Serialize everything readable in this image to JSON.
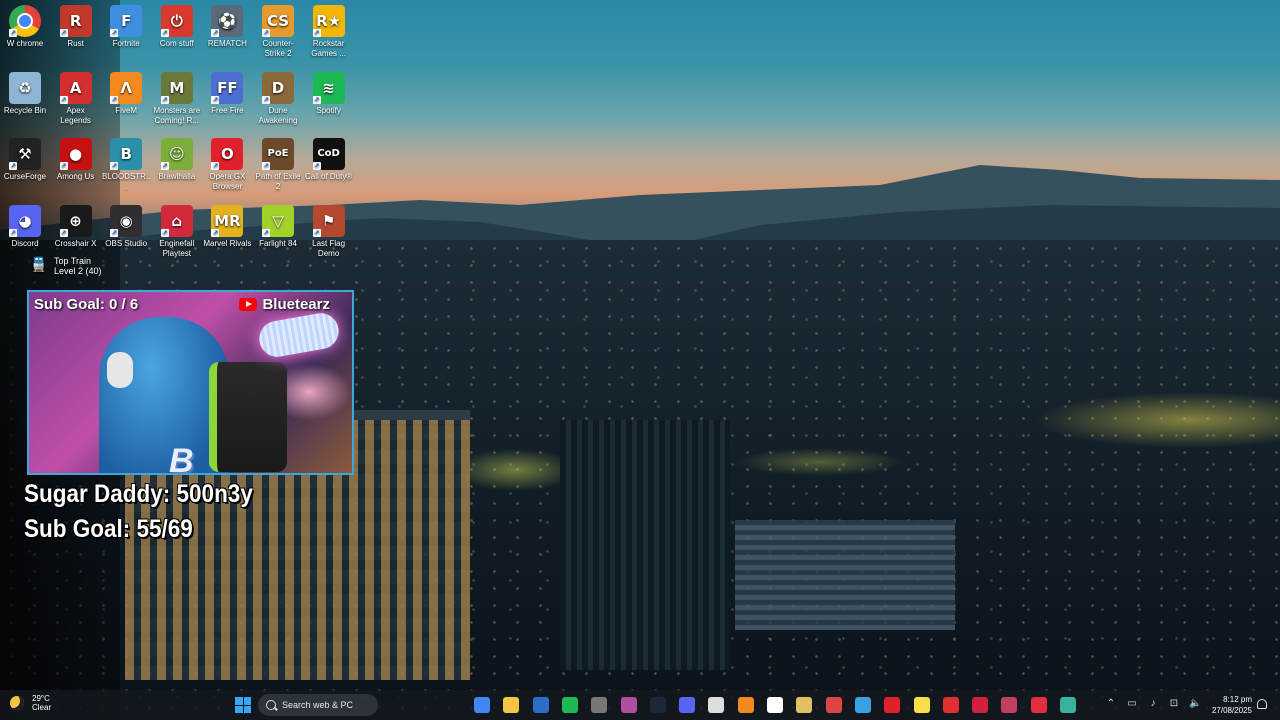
{
  "desktop_icons": [
    {
      "label": "W chrome",
      "icon": "chrome-icon",
      "glyph": "",
      "color": "#e5413a",
      "col": 0,
      "row": 0
    },
    {
      "label": "Rust",
      "icon": "rust-icon",
      "glyph": "R",
      "color": "#c0392b",
      "col": 1,
      "row": 0
    },
    {
      "label": "Fortnite",
      "icon": "fortnite-icon",
      "glyph": "F",
      "color": "#3f8fe0",
      "col": 2,
      "row": 0
    },
    {
      "label": "Com stuff",
      "icon": "power-icon",
      "glyph": "⏻",
      "color": "#d93a2e",
      "col": 3,
      "row": 0
    },
    {
      "label": "REMATCH",
      "icon": "rematch-icon",
      "glyph": "⚽",
      "color": "#5a6a7a",
      "col": 4,
      "row": 0
    },
    {
      "label": "Counter-Strike 2",
      "icon": "counter-strike-icon",
      "glyph": "CS",
      "color": "#e79a2b",
      "col": 5,
      "row": 0
    },
    {
      "label": "Rockstar Games ...",
      "icon": "rockstar-icon",
      "glyph": "R★",
      "color": "#f2b705",
      "col": 6,
      "row": 0
    },
    {
      "label": "Recycle Bin",
      "icon": "recycle-bin-icon",
      "glyph": "♻",
      "color": "#8fb5d6",
      "col": 0,
      "row": 1
    },
    {
      "label": "Apex Legends",
      "icon": "apex-icon",
      "glyph": "A",
      "color": "#d32f2f",
      "col": 1,
      "row": 1
    },
    {
      "label": "FiveM",
      "icon": "fivem-icon",
      "glyph": "Λ",
      "color": "#f28a1e",
      "col": 2,
      "row": 1
    },
    {
      "label": "Monsters are Coming! R...",
      "icon": "monsters-icon",
      "glyph": "M",
      "color": "#6b7a3a",
      "col": 3,
      "row": 1
    },
    {
      "label": "Free Fire",
      "icon": "free-fire-icon",
      "glyph": "FF",
      "color": "#4d6fd1",
      "col": 4,
      "row": 1
    },
    {
      "label": "Dune Awakening",
      "icon": "dune-icon",
      "glyph": "D",
      "color": "#8a6a3a",
      "col": 5,
      "row": 1
    },
    {
      "label": "Spotify",
      "icon": "spotify-icon",
      "glyph": "≋",
      "color": "#1db954",
      "col": 6,
      "row": 1
    },
    {
      "label": "CurseForge",
      "icon": "curseforge-icon",
      "glyph": "⚒",
      "color": "#222222",
      "col": 0,
      "row": 2
    },
    {
      "label": "Among Us",
      "icon": "among-us-icon",
      "glyph": "●",
      "color": "#c51111",
      "col": 1,
      "row": 2
    },
    {
      "label": "BLOODSTR...",
      "icon": "bloodstrike-icon",
      "glyph": "B",
      "color": "#2a8fa8",
      "col": 2,
      "row": 2
    },
    {
      "label": "Brawlhalla",
      "icon": "brawlhalla-icon",
      "glyph": "☺",
      "color": "#7cae3a",
      "col": 3,
      "row": 2
    },
    {
      "label": "Opera GX Browser",
      "icon": "opera-gx-icon",
      "glyph": "O",
      "color": "#e0202a",
      "col": 4,
      "row": 2
    },
    {
      "label": "Path of Exile 2",
      "icon": "poe-icon",
      "glyph": "PoE",
      "color": "#6a4a2a",
      "col": 5,
      "row": 2
    },
    {
      "label": "Call of Duty®",
      "icon": "call-of-duty-icon",
      "glyph": "CoD",
      "color": "#111111",
      "col": 6,
      "row": 2
    },
    {
      "label": "Discord",
      "icon": "discord-icon",
      "glyph": "◕",
      "color": "#5865f2",
      "col": 0,
      "row": 3
    },
    {
      "label": "Crosshair X",
      "icon": "crosshair-icon",
      "glyph": "⊕",
      "color": "#1a1a1a",
      "col": 1,
      "row": 3
    },
    {
      "label": "OBS Studio",
      "icon": "obs-icon",
      "glyph": "◉",
      "color": "#302e31",
      "col": 2,
      "row": 3
    },
    {
      "label": "Enginefall Playtest",
      "icon": "enginefall-icon",
      "glyph": "⌂",
      "color": "#d12b3b",
      "col": 3,
      "row": 3
    },
    {
      "label": "Marvel Rivals",
      "icon": "marvel-rivals-icon",
      "glyph": "MR",
      "color": "#e4b21e",
      "col": 4,
      "row": 3
    },
    {
      "label": "Farlight 84",
      "icon": "farlight-icon",
      "glyph": "▽",
      "color": "#a3d12a",
      "col": 5,
      "row": 3
    },
    {
      "label": "Last Flag Demo",
      "icon": "last-flag-icon",
      "glyph": "⚑",
      "color": "#b5482f",
      "col": 6,
      "row": 3
    }
  ],
  "top_train": {
    "line1": "Top Train",
    "line2": "Level 2  (40)"
  },
  "webcam": {
    "sub_goal": "Sub Goal:  0 / 6",
    "channel": "Bluetearz"
  },
  "overlay": {
    "line1": "Sugar Daddy: 500n3y",
    "line2": "Sub Goal: 55/69"
  },
  "taskbar": {
    "weather_temp": "29°C",
    "weather_cond": "Clear",
    "search_placeholder": "Search web & PC",
    "apps": [
      {
        "name": "chrome-app",
        "color": "#4285f4"
      },
      {
        "name": "file-explorer-app",
        "color": "#f4c542"
      },
      {
        "name": "visual-studio-app",
        "color": "#2d6ec9"
      },
      {
        "name": "spotify-app",
        "color": "#1db954"
      },
      {
        "name": "cpu-app",
        "color": "#777777"
      },
      {
        "name": "obs-app",
        "color": "#b04fa0"
      },
      {
        "name": "steam-app",
        "color": "#1b2838"
      },
      {
        "name": "discord-app",
        "color": "#5865f2"
      },
      {
        "name": "capcut-app",
        "color": "#dddddd"
      },
      {
        "name": "vlc-app",
        "color": "#f08a1c"
      },
      {
        "name": "clipchamp-app",
        "color": "#ffffff"
      },
      {
        "name": "media-app",
        "color": "#e0c060"
      },
      {
        "name": "chrome-alt-app",
        "color": "#d44"
      },
      {
        "name": "photos-app",
        "color": "#3aa0e0"
      },
      {
        "name": "opera-app",
        "color": "#e0202a"
      },
      {
        "name": "notes-app",
        "color": "#f5e04a"
      },
      {
        "name": "record-app",
        "color": "#e03030"
      },
      {
        "name": "opera-gx-app",
        "color": "#d02040"
      },
      {
        "name": "text-app",
        "color": "#c04060"
      },
      {
        "name": "fn-app",
        "color": "#e03040"
      },
      {
        "name": "terminal-app",
        "color": "#3ab0a0"
      }
    ],
    "time": "8:12 pm",
    "date": "27/08/2025"
  }
}
